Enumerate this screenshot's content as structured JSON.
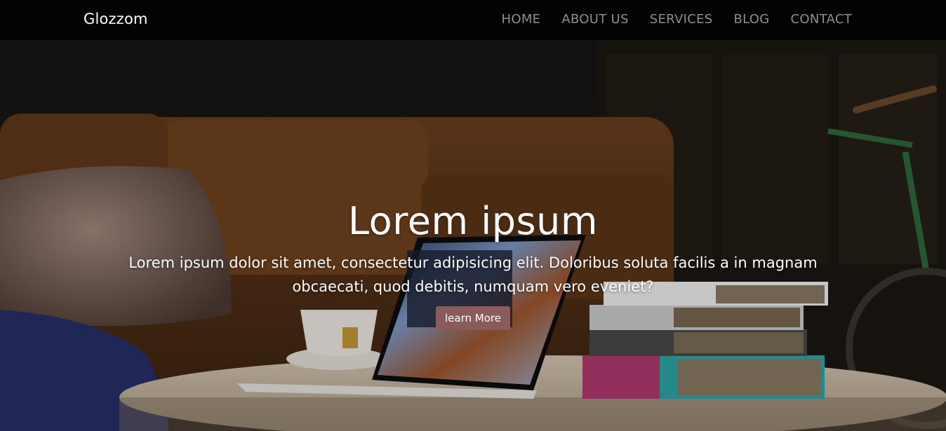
{
  "navbar": {
    "brand": "Glozzom",
    "links": [
      {
        "label": "HOME"
      },
      {
        "label": "ABOUT US"
      },
      {
        "label": "SERVICES"
      },
      {
        "label": "BLOG"
      },
      {
        "label": "CONTACT"
      }
    ]
  },
  "hero": {
    "title": "Lorem ipsum",
    "text": "Lorem ipsum dolor sit amet, consectetur adipisicing elit. Doloribus soluta facilis a in magnam obcaecati, quod debitis, numquam vero eveniet?",
    "button_label": "learn More",
    "background_image": "photo-of-laptop-coffee-cup-and-books-on-round-table"
  },
  "colors": {
    "navbar_bg": "#030303",
    "nav_link": "#8e8e8e",
    "button_bg": "#8b5b5b"
  }
}
